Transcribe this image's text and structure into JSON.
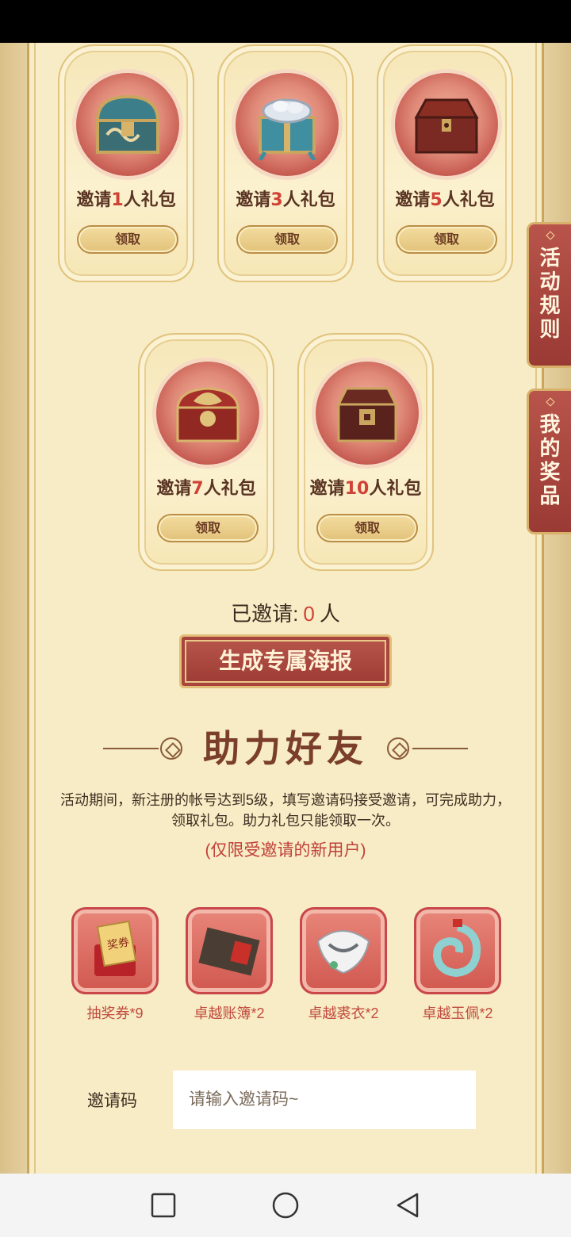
{
  "gifts": [
    {
      "prefix": "邀请",
      "num": "1",
      "suffix": "人礼包",
      "claim": "领取",
      "icon": "blue-chest-icon"
    },
    {
      "prefix": "邀请",
      "num": "3",
      "suffix": "人礼包",
      "claim": "领取",
      "icon": "silver-gift-chest-icon"
    },
    {
      "prefix": "邀请",
      "num": "5",
      "suffix": "人礼包",
      "claim": "领取",
      "icon": "red-chest-icon"
    },
    {
      "prefix": "邀请",
      "num": "7",
      "suffix": "人礼包",
      "claim": "领取",
      "icon": "dragon-chest-icon"
    },
    {
      "prefix": "邀请",
      "num": "10",
      "suffix": "人礼包",
      "claim": "领取",
      "icon": "wooden-chest-icon"
    }
  ],
  "side_tabs": {
    "rules": "活动规则",
    "prizes": "我的奖品"
  },
  "invited": {
    "label": "已邀请:",
    "count": "0",
    "unit": "人"
  },
  "poster_button": "生成专属海报",
  "section": {
    "title": "助力好友",
    "description": "活动期间，新注册的帐号达到5级，填写邀请码接受邀请，可完成助力，领取礼包。助力礼包只能领取一次。",
    "note": "(仅限受邀请的新用户)"
  },
  "rewards": [
    {
      "label": "抽奖券*9",
      "icon": "lottery-ticket-icon"
    },
    {
      "label": "卓越账簿*2",
      "icon": "ledger-book-icon"
    },
    {
      "label": "卓越裘衣*2",
      "icon": "fur-coat-icon"
    },
    {
      "label": "卓越玉佩*2",
      "icon": "jade-pendant-icon"
    }
  ],
  "invite_code": {
    "label": "邀请码",
    "placeholder": "请输入邀请码~",
    "value": ""
  },
  "colors": {
    "accent_red": "#d04236",
    "panel": "#f7ecc5",
    "button_red": "#a8463e"
  }
}
